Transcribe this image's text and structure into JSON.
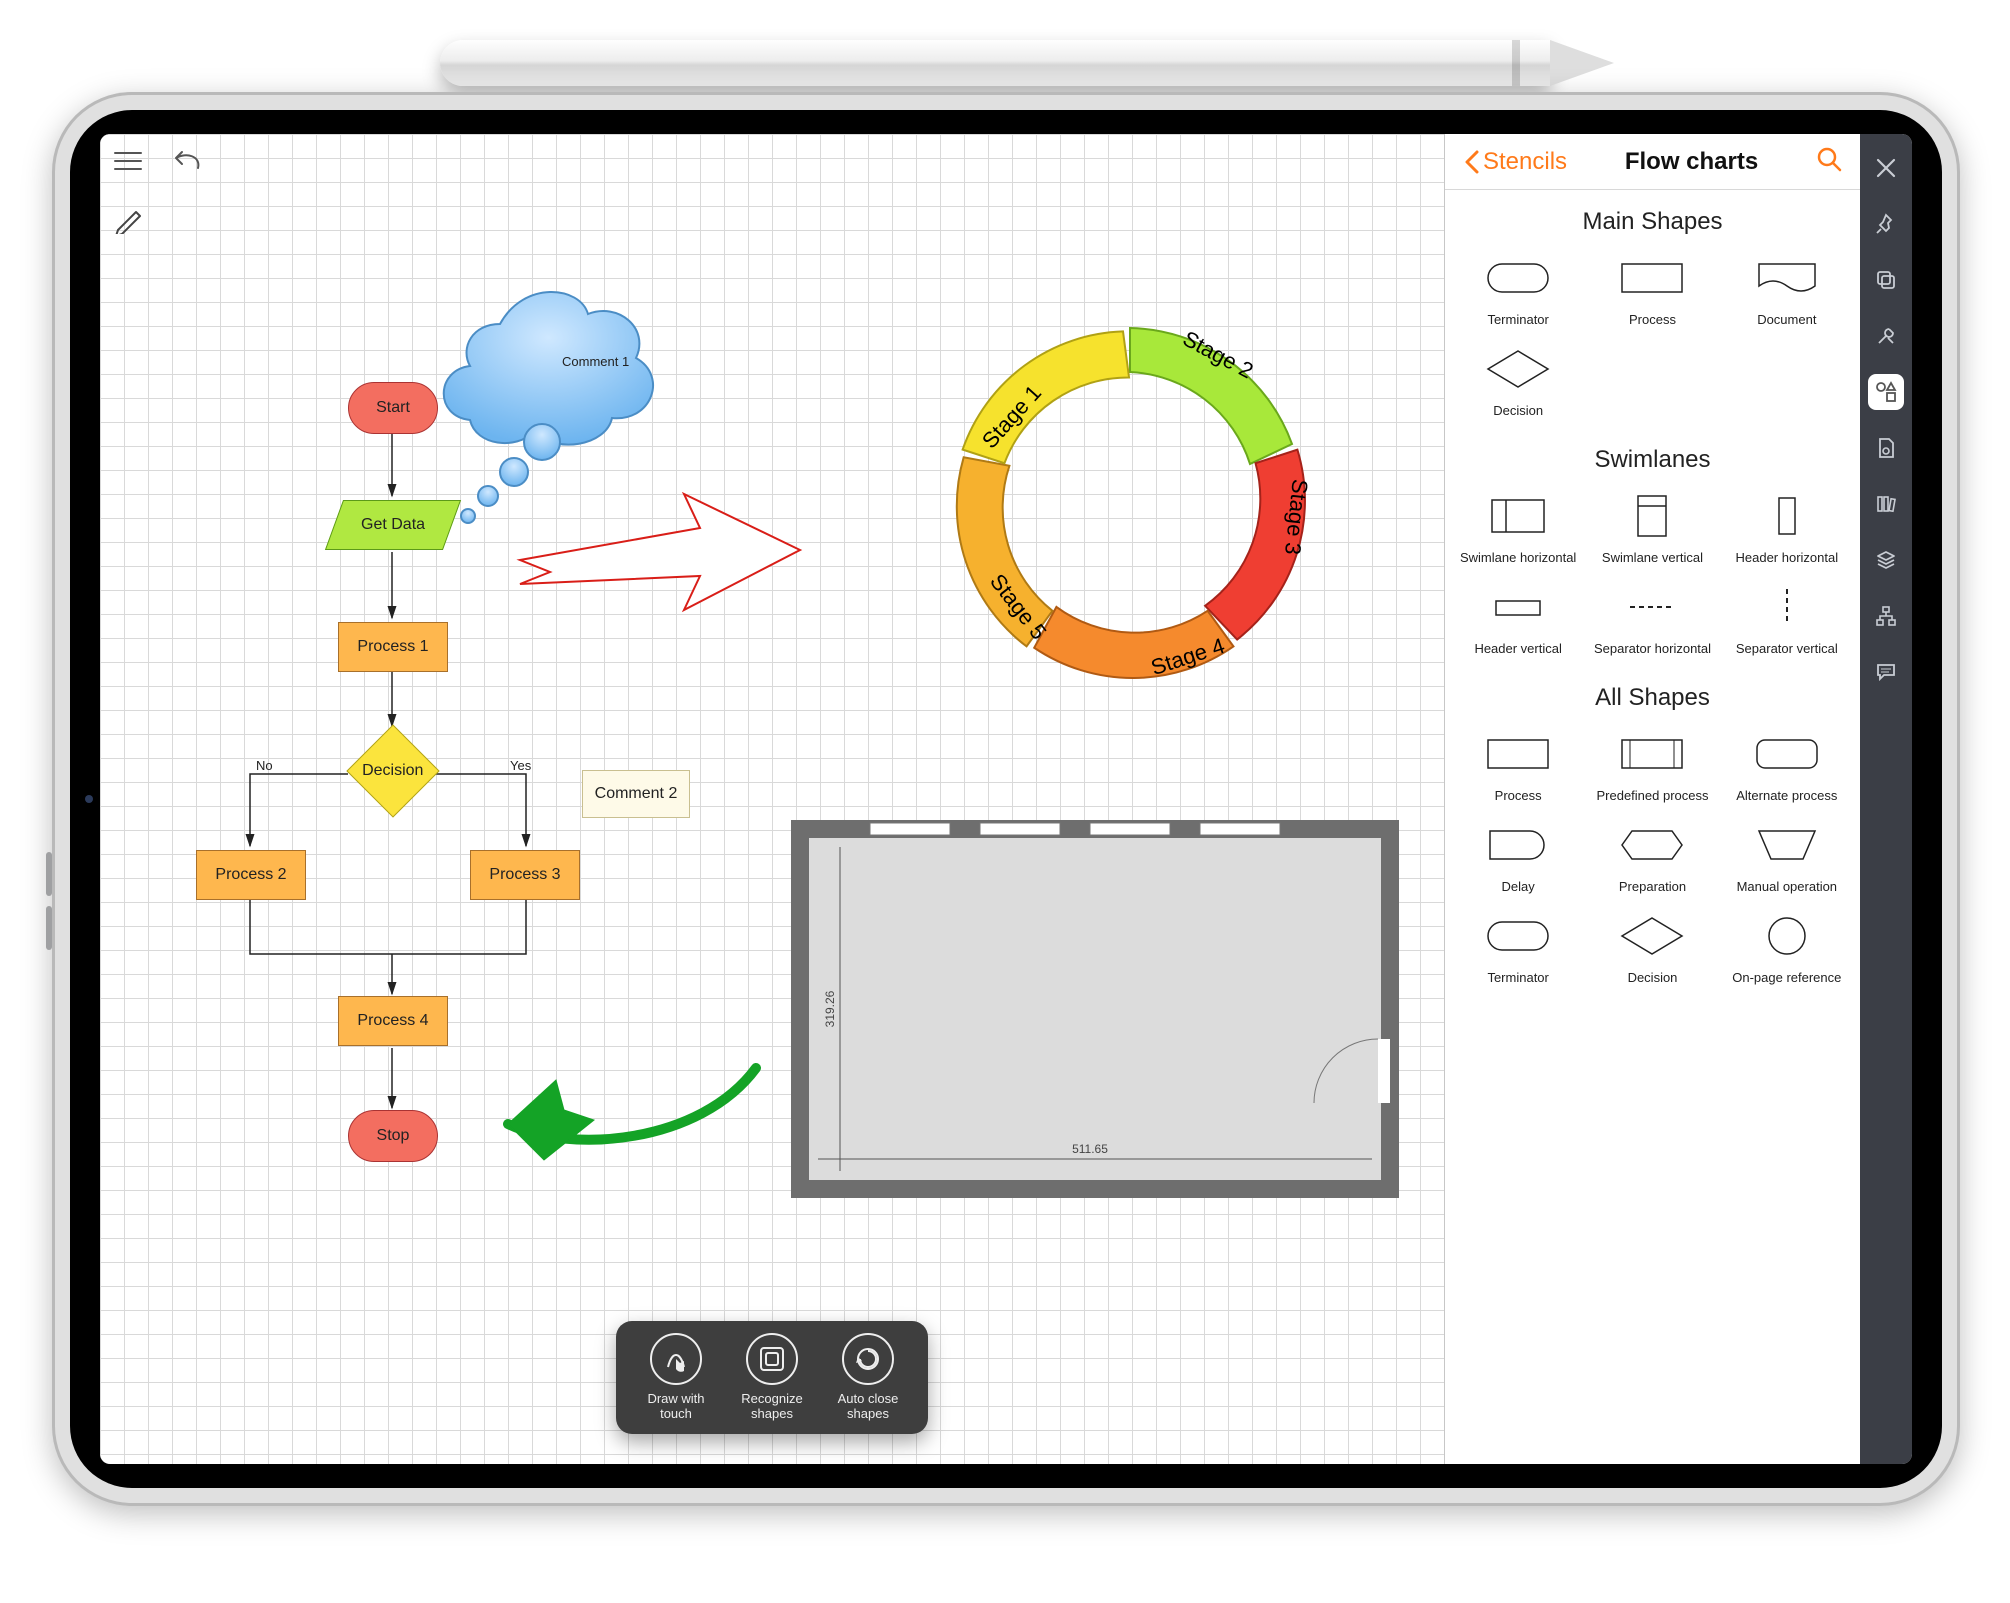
{
  "panel": {
    "back": "Stencils",
    "title": "Flow charts",
    "sections": {
      "main": "Main Shapes",
      "swim": "Swimlanes",
      "all": "All Shapes"
    },
    "shapes": {
      "terminator": "Terminator",
      "process": "Process",
      "document": "Document",
      "decision": "Decision",
      "swimH": "Swimlane horizontal",
      "swimV": "Swimlane vertical",
      "headH": "Header horizontal",
      "headV": "Header vertical",
      "sepH": "Separator horizontal",
      "sepV": "Separator vertical",
      "predef": "Predefined process",
      "altproc": "Alternate process",
      "delay": "Delay",
      "prep": "Preparation",
      "manual": "Manual operation",
      "onpage": "On-page reference"
    }
  },
  "hud": {
    "draw": "Draw with touch",
    "recognize": "Recognize shapes",
    "autoclose": "Auto close shapes"
  },
  "flow": {
    "start": "Start",
    "getdata": "Get Data",
    "p1": "Process 1",
    "decision": "Decision",
    "p2": "Process 2",
    "p3": "Process 3",
    "p4": "Process 4",
    "stop": "Stop",
    "c1": "Comment 1",
    "c2": "Comment 2",
    "no": "No",
    "yes": "Yes"
  },
  "stages": {
    "s1": "Stage 1",
    "s2": "Stage 2",
    "s3": "Stage 3",
    "s4": "Stage 4",
    "s5": "Stage 5"
  },
  "plan": {
    "w": "511.65",
    "h": "319.26"
  }
}
